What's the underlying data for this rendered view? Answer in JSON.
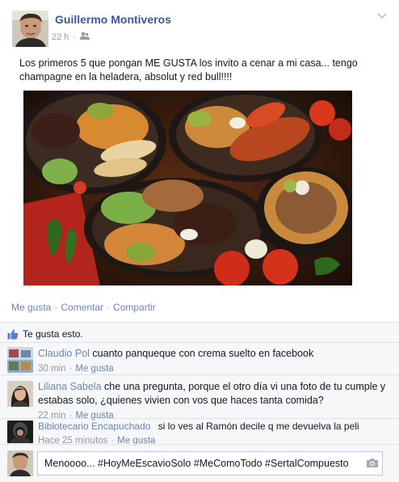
{
  "post": {
    "author": "Guillermo Montiveros",
    "time": "22 h",
    "text": "Los primeros 5 que pongan ME GUSTA los invito a cenar a mi casa... tengo champagne en la heladera, absolut y red bull!!!!",
    "actions": {
      "like": "Me gusta",
      "comment": "Comentar",
      "share": "Compartir",
      "separator": "·"
    }
  },
  "likes": {
    "text": "Te gusta esto."
  },
  "comments": [
    {
      "author": "Claudio Pol",
      "text": "cuanto panqueque con crema suelto en facebook",
      "time": "30 min",
      "like": "Me gusta"
    },
    {
      "author": "Liliana Sabela",
      "text": "che una pregunta, porque el otro día vi una foto de tu cumple y estabas solo, ¿quienes vivien con vos que haces tanta comida?",
      "time": "22 min",
      "like": "Me gusta"
    },
    {
      "author": "Biblotecario Encapuchado",
      "text": "si lo ves al Ramón decile q me devuelva la peli",
      "time": "Hace 25 minutos",
      "like": "Me gusta"
    }
  ],
  "composer": {
    "value": "Menoooo... #HoyMeEscavioSolo #MeComoTodo #SertalCompuesto"
  },
  "colors": {
    "link": "#3b5998",
    "muted": "#9197a3",
    "ufi_bg": "#f6f7f8"
  },
  "icons": [
    "friends-icon",
    "chevron-down-icon",
    "thumbs-up-icon",
    "camera-icon"
  ]
}
